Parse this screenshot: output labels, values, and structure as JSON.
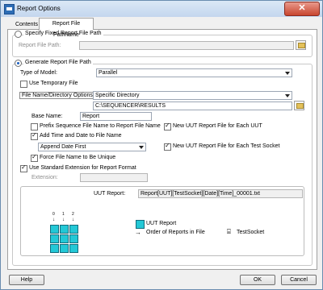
{
  "window": {
    "title": "Report Options",
    "close_symbol": "✕"
  },
  "tabs": [
    {
      "label": "Contents"
    },
    {
      "label": "Report File Pathname"
    }
  ],
  "fixed_path": {
    "radio_label": "Specify Fixed Report File Path",
    "field_label": "Report File Path:",
    "value": ""
  },
  "generate": {
    "radio_label": "Generate Report File Path",
    "type_of_model_label": "Type of Model:",
    "type_of_model_value": "Parallel",
    "use_temp_file_label": "Use Temporary File",
    "dir_options_label": "File Name/Directory Options:",
    "dir_options_value": "Specific Directory",
    "directory_value": "C:\\SEQUENCER\\RESULTS",
    "base_name_label": "Base Name:",
    "base_name_value": "Report",
    "prefix_seq_label": "Prefix Sequence File Name to Report File Name",
    "add_time_date_label": "Add Time and Date to File Name",
    "append_value": "Append Date First",
    "force_unique_label": "Force File Name to Be Unique",
    "new_per_uut_label": "New UUT Report File for Each UUT",
    "new_per_socket_label": "New UUT Report File for Each Test Socket",
    "use_std_ext_label": "Use Standard Extension for Report Format",
    "extension_label": "Extension:",
    "extension_value": ""
  },
  "preview": {
    "uut_report_label": "UUT Report:",
    "uut_report_value": "Report[UUT][TestSocket][Date][Time]_00001.txt",
    "legend_uut_report": "UUT Report",
    "legend_order": "Order of Reports in File",
    "legend_testsocket": "TestSocket",
    "socket_labels": [
      "0",
      "1",
      "2"
    ],
    "arrow_symbol": "→",
    "socket_symbol": "⌸"
  },
  "buttons": {
    "help": "Help",
    "ok": "OK",
    "cancel": "Cancel"
  },
  "checkbox_states": {
    "use_temp_file": false,
    "prefix_seq": false,
    "add_time_date": true,
    "force_unique": true,
    "new_per_uut": true,
    "new_per_socket": true,
    "use_std_ext": true
  }
}
